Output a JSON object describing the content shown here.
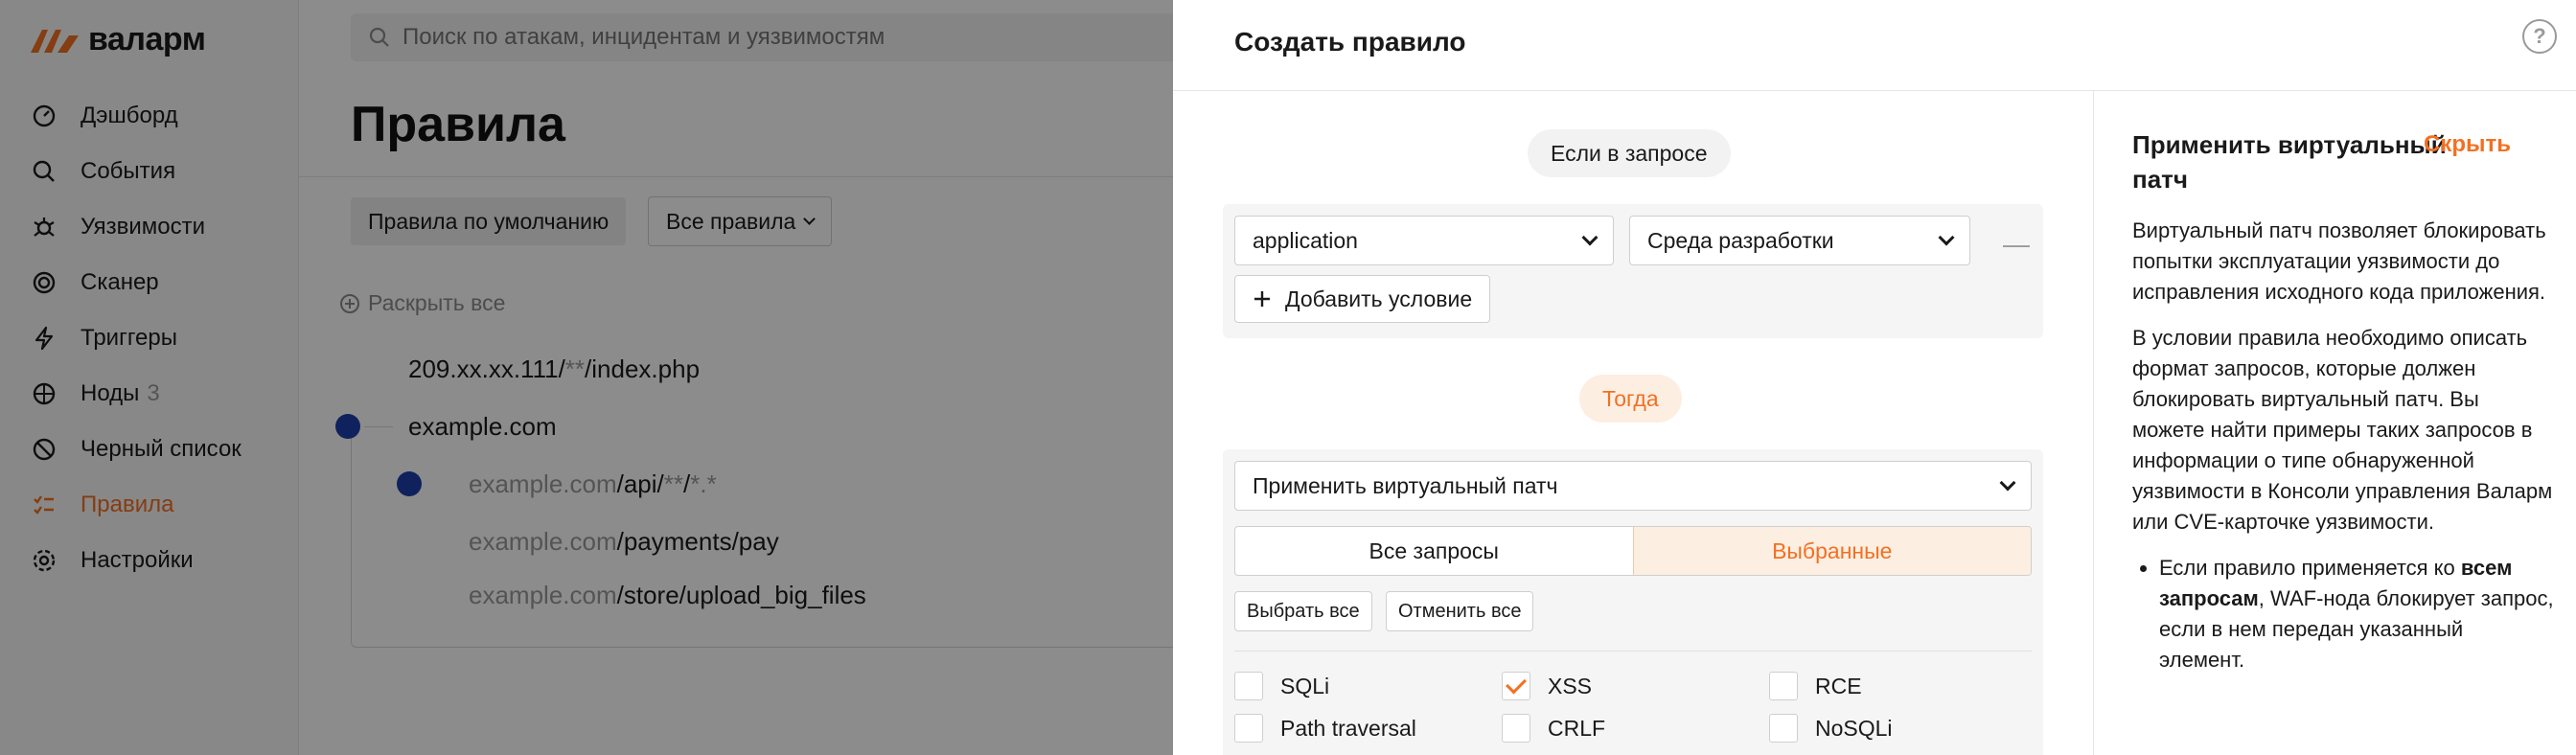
{
  "app": {
    "logo_text": "валарм",
    "search_placeholder": "Поиск по атакам, инцидентам и уязвимостям",
    "nav": [
      {
        "label": "Дэшборд",
        "icon": "dashboard-icon"
      },
      {
        "label": "События",
        "icon": "search-icon"
      },
      {
        "label": "Уязвимости",
        "icon": "bug-icon"
      },
      {
        "label": "Сканер",
        "icon": "scanner-icon"
      },
      {
        "label": "Триггеры",
        "icon": "lightning-icon"
      },
      {
        "label": "Ноды",
        "icon": "nodes-icon",
        "count": "3"
      },
      {
        "label": "Черный список",
        "icon": "blacklist-icon"
      },
      {
        "label": "Правила",
        "icon": "rules-icon",
        "active": true
      },
      {
        "label": "Настройки",
        "icon": "gear-icon"
      }
    ],
    "page_title": "Правила",
    "default_rules_button": "Правила по умолчанию",
    "rules_filter": "Все правила",
    "expand_all": "Раскрыть все",
    "tree": {
      "row1_host": "209.xx.xx.111/",
      "row1_wild": "**",
      "row1_path": "/index.php",
      "row2": "example.com",
      "row3_host": "example.com",
      "row3_api": "/api/",
      "row3_wild": "**",
      "row3_sep": "/",
      "row3_ext": "*.*",
      "row4_host": "example.com",
      "row4_path": "/payments/pay",
      "row5_host": "example.com",
      "row5_path": "/store/upload_big_files"
    }
  },
  "drawer": {
    "title": "Создать правило",
    "help_icon": "?",
    "if_label": "Если в запросе",
    "condition": {
      "point": "application",
      "value": "Среда разработки",
      "remove": "—",
      "add_label": "Добавить условие"
    },
    "then_label": "Тогда",
    "action": "Применить виртуальный патч",
    "scope": {
      "all": "Все запросы",
      "selected": "Выбранные"
    },
    "select_all": "Выбрать все",
    "cancel_all": "Отменить все",
    "attacks": [
      {
        "label": "SQLi",
        "checked": false
      },
      {
        "label": "XSS",
        "checked": true
      },
      {
        "label": "RCE",
        "checked": false
      },
      {
        "label": "Path traversal",
        "checked": false
      },
      {
        "label": "CRLF",
        "checked": false
      },
      {
        "label": "NoSQLi",
        "checked": false
      }
    ],
    "help": {
      "title": "Применить виртуальный патч",
      "hide": "Скрыть",
      "p1": "Виртуальный патч позволяет блокировать попытки эксплуатации уязвимости до исправления исходного кода приложения.",
      "p2": "В условии правила необходимо описать формат запросов, которые должен блокировать виртуальный патч. Вы можете найти примеры таких запросов в информации о типе обнаруженной уязвимости в Консоли управления Валарм или CVE-карточке уязвимости.",
      "li1_a": "Если правило применяется ко ",
      "li1_b": "всем запросам",
      "li1_c": ", WAF-нода блокирует запрос, если в нем передан указанный элемент."
    }
  },
  "colors": {
    "accent": "#f37021",
    "tree_dot": "#1c3faa"
  }
}
